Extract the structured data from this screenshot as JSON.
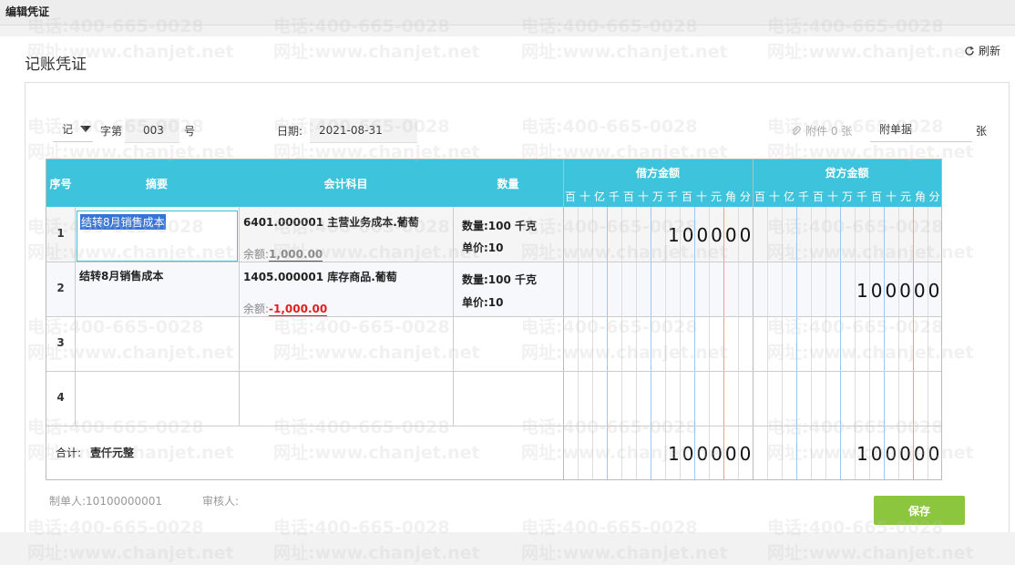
{
  "window": {
    "title": "编辑凭证"
  },
  "page": {
    "title": "记账凭证",
    "refresh_label": "刷新"
  },
  "header": {
    "voucher_type": "记",
    "zi_label": "字第",
    "voucher_no": "003",
    "hao_label": "号",
    "date_label": "日期:",
    "date_value": "2021-08-31",
    "attachment_label": "附件 0 张",
    "attach_docs_label": "附单据",
    "zhang_label": "张"
  },
  "table": {
    "col_seq": "序号",
    "col_summary": "摘要",
    "col_account": "会计科目",
    "col_qty": "数量",
    "col_debit": "借方金额",
    "col_credit": "贷方金额",
    "digit_labels": [
      "百",
      "十",
      "亿",
      "千",
      "百",
      "十",
      "万",
      "千",
      "百",
      "十",
      "元",
      "角",
      "分"
    ],
    "rows": [
      {
        "no": "1",
        "summary": "结转8月销售成本",
        "account": "6401.000001 主营业务成本.葡萄",
        "balance_label": "余额:",
        "balance": "1,000.00",
        "qty": "数量:100 千克",
        "price": "单价:10",
        "debit": "100000",
        "credit": ""
      },
      {
        "no": "2",
        "summary": "结转8月销售成本",
        "account": "1405.000001 库存商品.葡萄",
        "balance_label": "余额:",
        "balance": "-1,000.00",
        "qty": "数量:100 千克",
        "price": "单价:10",
        "debit": "",
        "credit": "100000"
      },
      {
        "no": "3",
        "summary": "",
        "account": "",
        "balance_label": "",
        "balance": "",
        "qty": "",
        "price": "",
        "debit": "",
        "credit": ""
      },
      {
        "no": "4",
        "summary": "",
        "account": "",
        "balance_label": "",
        "balance": "",
        "qty": "",
        "price": "",
        "debit": "",
        "credit": ""
      }
    ],
    "total_label": "合计:",
    "total_words": "壹仟元整",
    "total_debit": "100000",
    "total_credit": "100000"
  },
  "footer": {
    "maker_label": "制单人:",
    "maker_value": "10100000001",
    "reviewer_label": "审核人:",
    "save_label": "保存"
  },
  "watermark": {
    "phone": "电话:400-665-0028",
    "url": "网址:www.chanjet.net"
  },
  "colors": {
    "header_bg": "#3ec3dc",
    "save_bg": "#8cc63f",
    "selection": "#3874d8",
    "negative": "#e02020"
  }
}
